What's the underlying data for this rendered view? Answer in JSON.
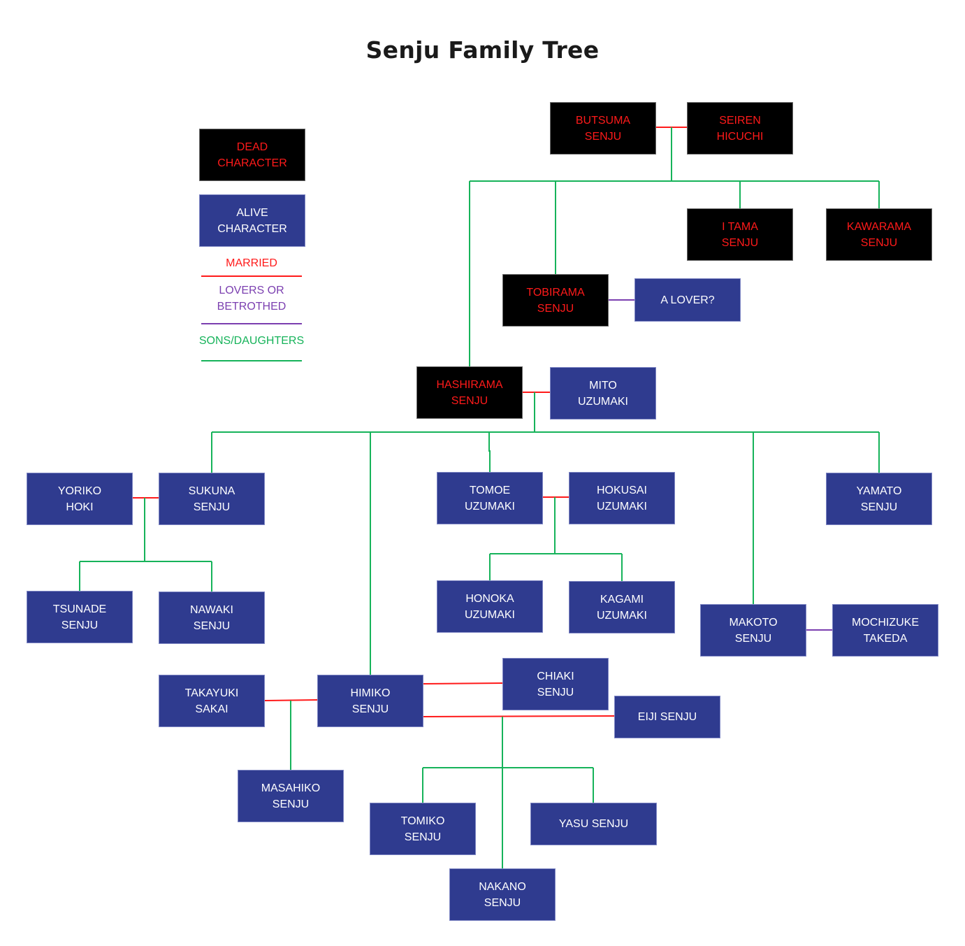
{
  "title": "Senju Family Tree",
  "colors": {
    "dead_bg": "#000000",
    "dead_text": "#ff1a1a",
    "alive_bg": "#2f3b8f",
    "alive_text": "#ffffff",
    "married": "#ff1a1a",
    "lovers": "#7b3fb0",
    "children": "#16b35a"
  },
  "legend": {
    "dead": "DEAD\nCHARACTER",
    "alive": "ALIVE\nCHARACTER",
    "married": "MARRIED",
    "lovers": "LOVERS OR\nBETROTHED",
    "children": "SONS/DAUGHTERS"
  },
  "people": {
    "butsuma": {
      "name": "BUTSUMA\nSENJU",
      "status": "dead"
    },
    "seiren": {
      "name": "SEIREN\nHICUCHI",
      "status": "dead"
    },
    "itama": {
      "name": "I TAMA\nSENJU",
      "status": "dead"
    },
    "kawarama": {
      "name": "KAWARAMA\nSENJU",
      "status": "dead"
    },
    "tobirama": {
      "name": "TOBIRAMA\nSENJU",
      "status": "dead"
    },
    "alover": {
      "name": "A LOVER?",
      "status": "alive"
    },
    "hashirama": {
      "name": "HASHIRAMA\nSENJU",
      "status": "dead"
    },
    "mito": {
      "name": "MITO\nUZUMAKI",
      "status": "alive"
    },
    "yoriko": {
      "name": "YORIKO\nHOKI",
      "status": "alive"
    },
    "sukuna": {
      "name": "SUKUNA\nSENJU",
      "status": "alive"
    },
    "tomoe": {
      "name": "TOMOE\nUZUMAKI",
      "status": "alive"
    },
    "hokusai": {
      "name": "HOKUSAI\nUZUMAKI",
      "status": "alive"
    },
    "yamato": {
      "name": "YAMATO\nSENJU",
      "status": "alive"
    },
    "tsunade": {
      "name": "TSUNADE\nSENJU",
      "status": "alive"
    },
    "nawaki": {
      "name": "NAWAKI\nSENJU",
      "status": "alive"
    },
    "honoka": {
      "name": "HONOKA\nUZUMAKI",
      "status": "alive"
    },
    "kagami": {
      "name": "KAGAMI\nUZUMAKI",
      "status": "alive"
    },
    "makoto": {
      "name": "MAKOTO\nSENJU",
      "status": "alive"
    },
    "mochizuke": {
      "name": "MOCHIZUKE\nTAKEDA",
      "status": "alive"
    },
    "takayuki": {
      "name": "TAKAYUKI\nSAKAI",
      "status": "alive"
    },
    "himiko": {
      "name": "HIMIKO\nSENJU",
      "status": "alive"
    },
    "chiaki": {
      "name": "CHIAKI\nSENJU",
      "status": "alive"
    },
    "eiji": {
      "name": "EIJI SENJU",
      "status": "alive"
    },
    "masahiko": {
      "name": "MASAHIKO\nSENJU",
      "status": "alive"
    },
    "tomiko": {
      "name": "TOMIKO\nSENJU",
      "status": "alive"
    },
    "yasu": {
      "name": "YASU SENJU",
      "status": "alive"
    },
    "nakano": {
      "name": "NAKANO\nSENJU",
      "status": "alive"
    }
  },
  "relations": {
    "married": [
      [
        "butsuma",
        "seiren"
      ],
      [
        "hashirama",
        "mito"
      ],
      [
        "yoriko",
        "sukuna"
      ],
      [
        "tomoe",
        "hokusai"
      ],
      [
        "takayuki",
        "himiko"
      ],
      [
        "himiko",
        "chiaki"
      ],
      [
        "himiko",
        "eiji"
      ]
    ],
    "lovers": [
      [
        "tobirama",
        "alover"
      ],
      [
        "makoto",
        "mochizuke"
      ]
    ],
    "children": [
      {
        "parents": [
          "butsuma",
          "seiren"
        ],
        "children": [
          "hashirama",
          "tobirama",
          "itama",
          "kawarama"
        ]
      },
      {
        "parents": [
          "hashirama",
          "mito"
        ],
        "children": [
          "sukuna",
          "himiko",
          "tomoe",
          "makoto",
          "yamato"
        ]
      },
      {
        "parents": [
          "yoriko",
          "sukuna"
        ],
        "children": [
          "tsunade",
          "nawaki"
        ]
      },
      {
        "parents": [
          "tomoe",
          "hokusai"
        ],
        "children": [
          "honoka",
          "kagami"
        ]
      },
      {
        "parents": [
          "takayuki",
          "himiko"
        ],
        "children": [
          "masahiko"
        ]
      },
      {
        "parents": [
          "himiko",
          "eiji"
        ],
        "children": [
          "tomiko",
          "nakano",
          "yasu"
        ]
      }
    ]
  }
}
